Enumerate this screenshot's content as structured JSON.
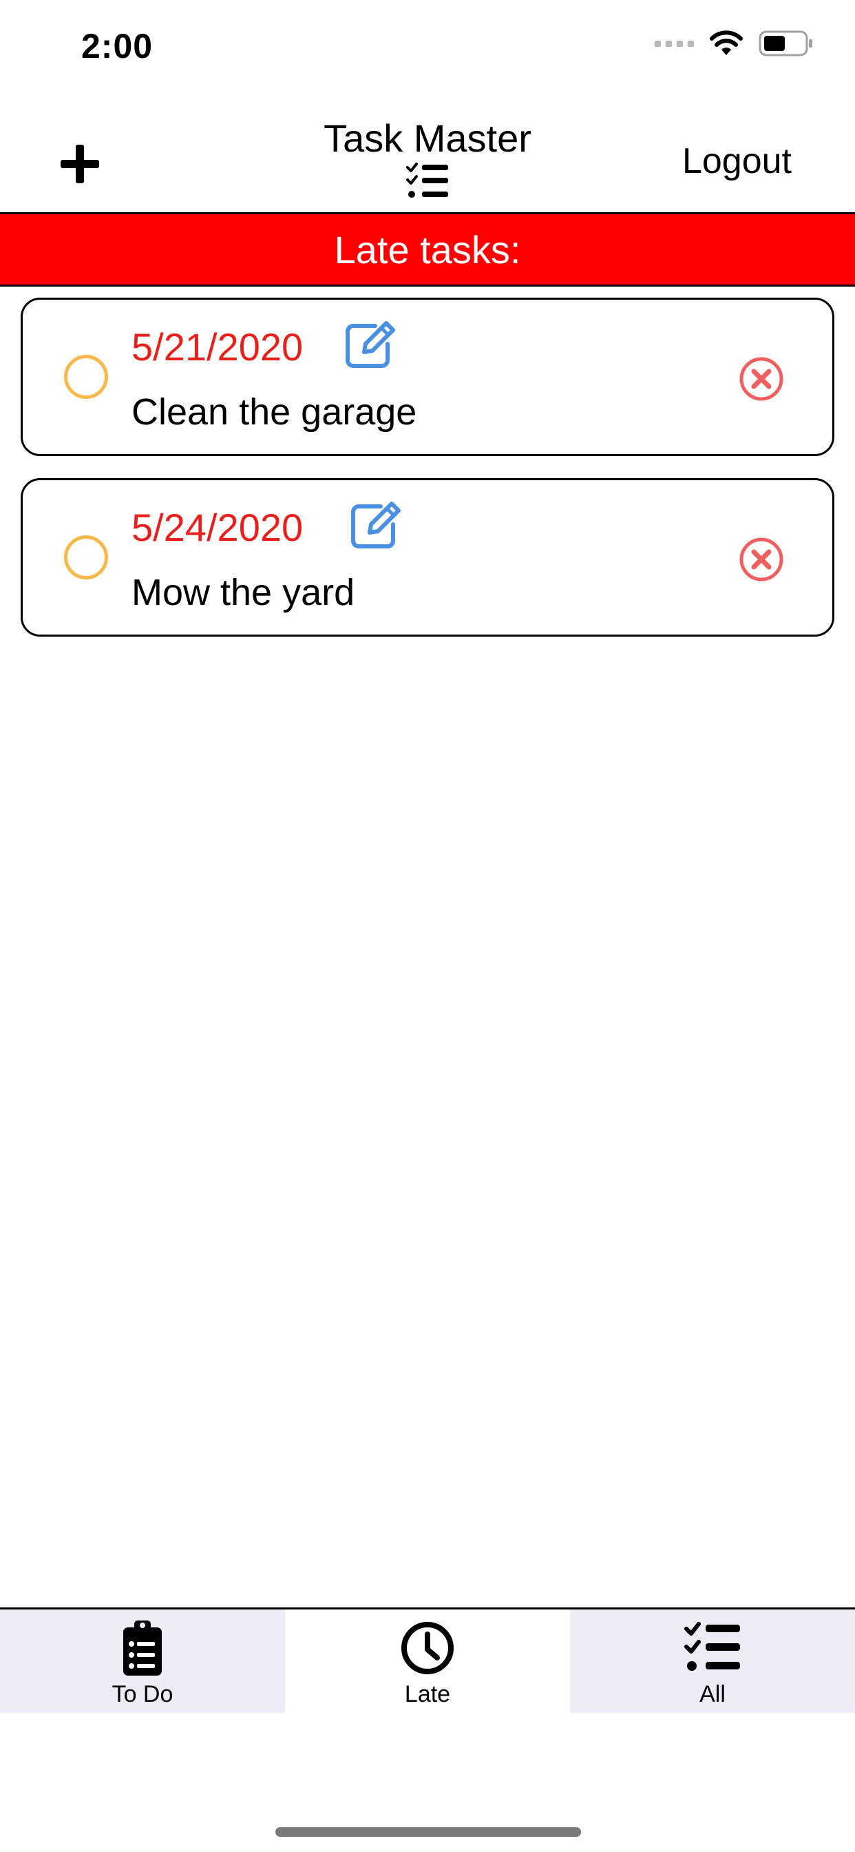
{
  "status_bar": {
    "time": "2:00",
    "icons": [
      "signal-icon",
      "wifi-icon",
      "battery-icon"
    ]
  },
  "header": {
    "add_icon": "plus-icon",
    "title": "Task Master",
    "title_icon": "checklist-icon",
    "logout_label": "Logout"
  },
  "banner": {
    "label": "Late tasks:",
    "color": "#ff0000"
  },
  "tasks": [
    {
      "date": "5/21/2020",
      "name": "Clean the garage"
    },
    {
      "date": "5/24/2020",
      "name": "Mow the yard"
    }
  ],
  "colors": {
    "date": "#e8201c",
    "complete_circle": "#f8b84a",
    "edit_icon": "#4a90e2",
    "delete_icon": "#ef5f5f",
    "tab_inactive_bg": "#ececf7"
  },
  "tabs": [
    {
      "label": "To Do",
      "icon": "clipboard-icon",
      "active": false
    },
    {
      "label": "Late",
      "icon": "clock-icon",
      "active": true
    },
    {
      "label": "All",
      "icon": "checklist-icon",
      "active": false
    }
  ]
}
